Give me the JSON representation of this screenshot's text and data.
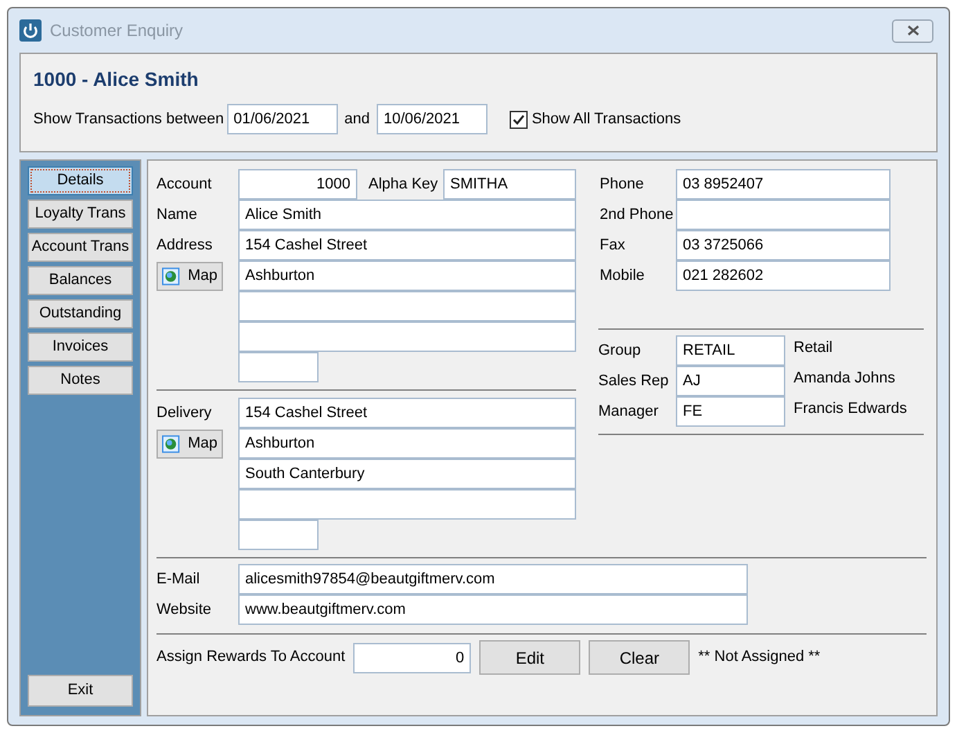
{
  "window": {
    "title": "Customer Enquiry"
  },
  "header": {
    "title": "1000 - Alice Smith",
    "range_label": "Show Transactions between",
    "date_from": "01/06/2021",
    "and_label": "and",
    "date_to": "10/06/2021",
    "show_all": {
      "label": "Show All Transactions",
      "checked": true
    }
  },
  "sidebar": {
    "items": [
      {
        "label": "Details",
        "selected": true
      },
      {
        "label": "Loyalty Trans",
        "selected": false
      },
      {
        "label": "Account Trans",
        "selected": false
      },
      {
        "label": "Balances",
        "selected": false
      },
      {
        "label": "Outstanding",
        "selected": false
      },
      {
        "label": "Invoices",
        "selected": false
      },
      {
        "label": "Notes",
        "selected": false
      }
    ],
    "exit": "Exit"
  },
  "account": {
    "label": "Account",
    "value": "1000",
    "alpha_label": "Alpha Key",
    "alpha_value": "SMITHA"
  },
  "name": {
    "label": "Name",
    "value": "Alice Smith"
  },
  "address": {
    "label": "Address",
    "map": "Map",
    "lines": [
      "154 Cashel Street",
      "Ashburton"
    ]
  },
  "delivery": {
    "label": "Delivery",
    "map": "Map",
    "lines": [
      "154 Cashel Street",
      "Ashburton",
      "South Canterbury"
    ]
  },
  "phones": [
    {
      "label": "Phone",
      "value": "03 8952407"
    },
    {
      "label": "2nd Phone"
    },
    {
      "label": "Fax",
      "value": "03 3725066"
    },
    {
      "label": "Mobile",
      "value": "021 282602"
    }
  ],
  "assignments": [
    {
      "label": "Group",
      "code": "RETAIL",
      "description": "Retail"
    },
    {
      "label": "Sales Rep",
      "code": "AJ",
      "description": "Amanda Johns"
    },
    {
      "label": "Manager",
      "code": "FE",
      "description": "Francis Edwards"
    }
  ],
  "contact": [
    {
      "label": "E-Mail",
      "value": "alicesmith97854@beautgiftmerv.com"
    },
    {
      "label": "Website",
      "value": "www.beautgiftmerv.com"
    }
  ],
  "rewards": {
    "label": "Assign Rewards To Account",
    "value": "0",
    "edit": "Edit",
    "clear": "Clear",
    "status": "** Not Assigned **"
  }
}
